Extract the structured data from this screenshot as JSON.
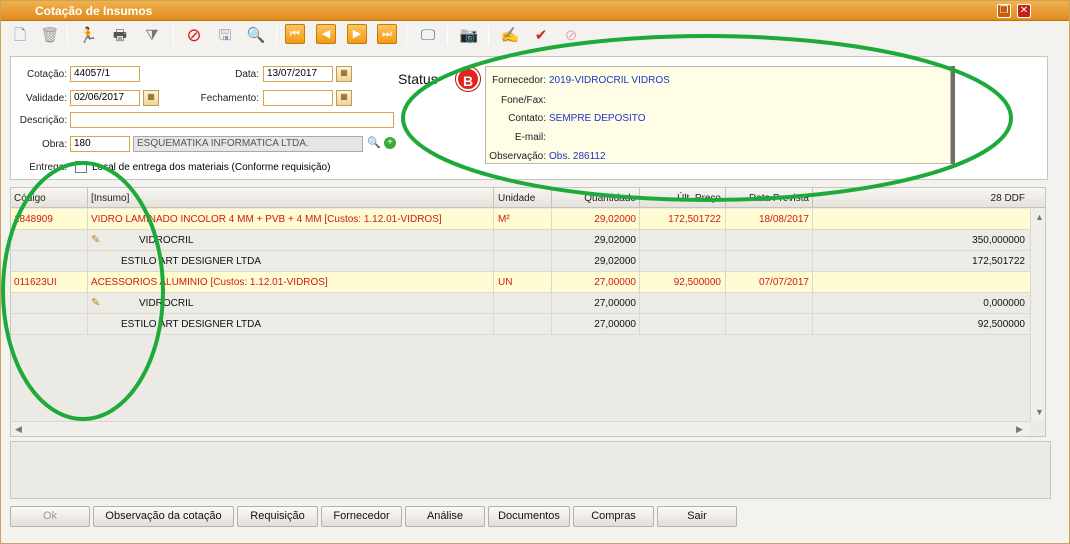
{
  "window": {
    "title": "Cotação de Insumos",
    "restore_icon": "restore-icon",
    "close_icon": "close-icon"
  },
  "toolbar": {
    "icons": [
      "new-document-icon",
      "delete-icon",
      "run-icon",
      "print-icon",
      "filter-icon",
      "cancel-icon",
      "save-icon",
      "search-icon",
      "first-icon",
      "previous-icon",
      "next-icon",
      "last-icon",
      "screen-icon",
      "camera-icon",
      "approve-icon",
      "approve-check-icon",
      "disapprove-icon"
    ]
  },
  "form": {
    "cotacao_label": "Cotação:",
    "cotacao_value": "44057/1",
    "data_label": "Data:",
    "data_value": "13/07/2017",
    "validade_label": "Validade:",
    "validade_value": "02/06/2017",
    "fechamento_label": "Fechamento:",
    "fechamento_value": "",
    "descricao_label": "Descrição:",
    "descricao_value": "",
    "obra_label": "Obra:",
    "obra_code": "180",
    "obra_name": "ESQUEMATIKA INFORMATICA LTDA.",
    "entrega_label": "Entrega:",
    "entrega_text": "Local de entrega dos materiais (Conforme requisição)",
    "status_label": "Status",
    "status_badge": "B"
  },
  "supplier": {
    "fornecedor_label": "Fornecedor:",
    "fornecedor_value": "2019-VIDROCRIL VIDROS",
    "fone_label": "Fone/Fax:",
    "fone_value": "",
    "contato_label": "Contato:",
    "contato_value": "SEMPRE DEPOSITO",
    "email_label": "E-mail:",
    "email_value": "",
    "obs_label": "Observação:",
    "obs_value": "Obs. 286112"
  },
  "grid": {
    "headers": {
      "codigo": "Código",
      "insumo": "[Insumo]",
      "unidade": "Unidade",
      "quantidade": "Quantidade",
      "ult_preco": "Últ. Preço",
      "data_prevista": "Data Prevista",
      "ddf": "28 DDF"
    },
    "rows": [
      {
        "type": "main",
        "codigo": "1848909",
        "insumo": "VIDRO LAMINADO INCOLOR 4 MM + PVB + 4 MM [Custos: 1.12.01-VIDROS]",
        "unidade": "M²",
        "quantidade": "29,02000",
        "ult_preco": "172,501722",
        "data_prevista": "18/08/2017",
        "ddf": ""
      },
      {
        "type": "sub",
        "note": true,
        "insumo": "VIDROCRIL",
        "quantidade": "29,02000",
        "ddf": "350,000000"
      },
      {
        "type": "sub",
        "note": false,
        "insumo": "ESTILO ART DESIGNER LTDA",
        "quantidade": "29,02000",
        "ddf": "172,501722"
      },
      {
        "type": "main",
        "codigo": "011623UI",
        "insumo": "ACESSORIOS ALUMINIO [Custos: 1.12.01-VIDROS]",
        "unidade": "UN",
        "quantidade": "27,00000",
        "ult_preco": "92,500000",
        "data_prevista": "07/07/2017",
        "ddf": ""
      },
      {
        "type": "sub",
        "note": true,
        "insumo": "VIDROCRIL",
        "quantidade": "27,00000",
        "ddf": "0,000000"
      },
      {
        "type": "sub",
        "note": false,
        "insumo": "ESTILO ART DESIGNER LTDA",
        "quantidade": "27,00000",
        "ddf": "92,500000"
      }
    ]
  },
  "buttons": {
    "ok": "Ok",
    "obs_cotacao": "Observação da cotação",
    "requisicao": "Requisição",
    "fornecedor": "Fornecedor",
    "analise": "Análise",
    "documentos": "Documentos",
    "compras": "Compras",
    "sair": "Sair"
  },
  "colors": {
    "title_bar": "#e8981f",
    "main_row_text": "#d01b12",
    "main_row_bg": "#fffbd3",
    "supplier_text": "#1d35c7",
    "annotation": "#1eaa3a"
  }
}
